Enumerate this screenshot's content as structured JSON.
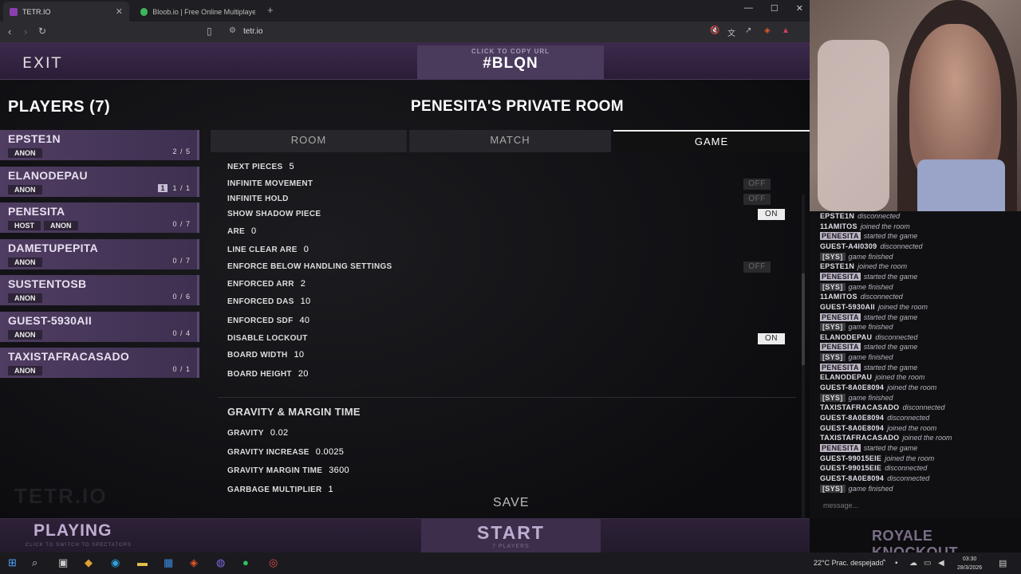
{
  "browser": {
    "tabs": [
      {
        "title": "TETR.IO",
        "active": true
      },
      {
        "title": "Bloob.io | Free Online Multiplayer Ga",
        "active": false
      }
    ],
    "url": "tetr.io"
  },
  "game": {
    "exit_label": "EXIT",
    "copy_url_label": "CLICK TO COPY URL",
    "room_code": "#BLQN",
    "players_title": "PLAYERS (7)",
    "room_title": "PENESITA'S PRIVATE ROOM",
    "players": [
      {
        "name": "EPSTE1N",
        "badges": [
          "ANON"
        ],
        "score": "2 / 5",
        "sup": ""
      },
      {
        "name": "ELANODEPAU",
        "badges": [
          "ANON"
        ],
        "score": "1 / 1",
        "sup": "1"
      },
      {
        "name": "PENESITA",
        "badges": [
          "HOST",
          "ANON"
        ],
        "score": "0 / 7",
        "sup": ""
      },
      {
        "name": "DAMETUPEPITA",
        "badges": [
          "ANON"
        ],
        "score": "0 / 7",
        "sup": ""
      },
      {
        "name": "SUSTENTOSB",
        "badges": [
          "ANON"
        ],
        "score": "0 / 6",
        "sup": ""
      },
      {
        "name": "GUEST-5930AII",
        "badges": [
          "ANON"
        ],
        "score": "0 / 4",
        "sup": ""
      },
      {
        "name": "TAXISTAFRACASADO",
        "badges": [
          "ANON"
        ],
        "score": "0 / 1",
        "sup": ""
      }
    ],
    "tabs": [
      "ROOM",
      "MATCH",
      "GAME"
    ],
    "active_tab": "GAME",
    "settings": [
      {
        "label": "NEXT PIECES",
        "value": "5"
      },
      {
        "label": "INFINITE MOVEMENT",
        "toggle": "OFF"
      },
      {
        "label": "INFINITE HOLD",
        "toggle": "OFF"
      },
      {
        "label": "SHOW SHADOW PIECE",
        "toggle": "ON"
      },
      {
        "label": "ARE",
        "value": "0"
      },
      {
        "label": "LINE CLEAR ARE",
        "value": "0"
      },
      {
        "label": "ENFORCE BELOW HANDLING SETTINGS",
        "toggle": "OFF"
      },
      {
        "label": "ENFORCED ARR",
        "value": "2"
      },
      {
        "label": "ENFORCED DAS",
        "value": "10"
      },
      {
        "label": "ENFORCED SDF",
        "value": "40"
      },
      {
        "label": "DISABLE LOCKOUT",
        "toggle": "ON"
      },
      {
        "label": "BOARD WIDTH",
        "value": "10"
      },
      {
        "label": "BOARD HEIGHT",
        "value": "20"
      }
    ],
    "section2_title": "GRAVITY & MARGIN TIME",
    "settings2": [
      {
        "label": "GRAVITY",
        "value": "0.02"
      },
      {
        "label": "GRAVITY INCREASE",
        "value": "0.0025"
      },
      {
        "label": "GRAVITY MARGIN TIME",
        "value": "3600"
      },
      {
        "label": "GARBAGE MULTIPLIER",
        "value": "1"
      }
    ],
    "save_label": "SAVE",
    "playing_label": "PLAYING",
    "spectate_hint": "CLICK TO SWITCH TO SPECTATORS",
    "start_label": "START",
    "start_sub": "7 PLAYERS",
    "watermark": "TETR.IO",
    "royale": "ROYALE KNOCKOUT"
  },
  "chat": {
    "lines": [
      {
        "who": "EPSTE1N",
        "style": "plain",
        "msg": "disconnected"
      },
      {
        "who": "11AMITOS",
        "style": "plain",
        "msg": "joined the room"
      },
      {
        "who": "PENESITA",
        "style": "tag",
        "msg": "started the game"
      },
      {
        "who": "GUEST-A4I0309",
        "style": "plain",
        "msg": "disconnected"
      },
      {
        "who": "[SYS]",
        "style": "sys",
        "msg": "game finished"
      },
      {
        "who": "EPSTE1N",
        "style": "plain",
        "msg": "joined the room"
      },
      {
        "who": "PENESITA",
        "style": "tag",
        "msg": "started the game"
      },
      {
        "who": "[SYS]",
        "style": "sys",
        "msg": "game finished"
      },
      {
        "who": "11AMITOS",
        "style": "plain",
        "msg": "disconnected"
      },
      {
        "who": "GUEST-5930AII",
        "style": "plain",
        "msg": "joined the room"
      },
      {
        "who": "PENESITA",
        "style": "tag",
        "msg": "started the game"
      },
      {
        "who": "[SYS]",
        "style": "sys",
        "msg": "game finished"
      },
      {
        "who": "ELANODEPAU",
        "style": "plain",
        "msg": "disconnected"
      },
      {
        "who": "PENESITA",
        "style": "tag",
        "msg": "started the game"
      },
      {
        "who": "[SYS]",
        "style": "sys",
        "msg": "game finished"
      },
      {
        "who": "PENESITA",
        "style": "tag",
        "msg": "started the game"
      },
      {
        "who": "ELANODEPAU",
        "style": "plain",
        "msg": "joined the room"
      },
      {
        "who": "GUEST-8A0E8094",
        "style": "plain",
        "msg": "joined the room"
      },
      {
        "who": "[SYS]",
        "style": "sys",
        "msg": "game finished"
      },
      {
        "who": "TAXISTAFRACASADO",
        "style": "plain",
        "msg": "disconnected"
      },
      {
        "who": "GUEST-8A0E8094",
        "style": "plain",
        "msg": "disconnected"
      },
      {
        "who": "GUEST-8A0E8094",
        "style": "plain",
        "msg": "joined the room"
      },
      {
        "who": "TAXISTAFRACASADO",
        "style": "plain",
        "msg": "joined the room"
      },
      {
        "who": "PENESITA",
        "style": "tag",
        "msg": "started the game"
      },
      {
        "who": "GUEST-99015EIE",
        "style": "plain",
        "msg": "joined the room"
      },
      {
        "who": "GUEST-99015EIE",
        "style": "plain",
        "msg": "disconnected"
      },
      {
        "who": "GUEST-8A0E8094",
        "style": "plain",
        "msg": "disconnected"
      },
      {
        "who": "[SYS]",
        "style": "sys",
        "msg": "game finished"
      }
    ],
    "placeholder": "message..."
  },
  "taskbar": {
    "weather": "22°C  Prac. despejado",
    "time": "03:30",
    "date": "28/3/2026"
  }
}
